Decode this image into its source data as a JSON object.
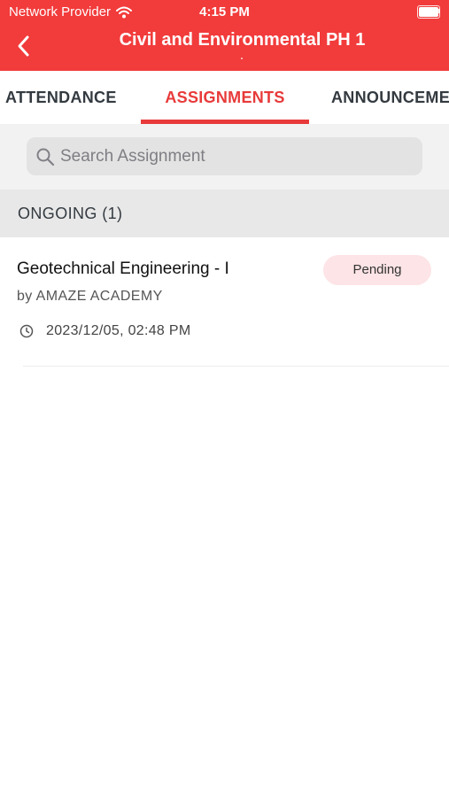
{
  "status_bar": {
    "carrier": "Network Provider",
    "time": "4:15 PM",
    "icons": [
      "wifi-icon",
      "battery-icon"
    ]
  },
  "nav": {
    "title": "Civil and Environmental PH 1",
    "back_icon": "chevron-left-icon"
  },
  "tabs": [
    {
      "label": "ATTENDANCE",
      "active": false
    },
    {
      "label": "ASSIGNMENTS",
      "active": true
    },
    {
      "label": "ANNOUNCEMENTS",
      "active": false
    }
  ],
  "search": {
    "placeholder": "Search Assignment",
    "value": "",
    "icon": "search-icon"
  },
  "section": {
    "title": "ONGOING (1)"
  },
  "assignments": [
    {
      "title": "Geotechnical Engineering - I",
      "author": "by AMAZE ACADEMY",
      "status": "Pending",
      "datetime": "2023/12/05, 02:48 PM",
      "icon": "clock-icon"
    }
  ],
  "colors": {
    "primary": "#f23b3b",
    "active_tab": "#e83a3a",
    "badge_bg": "#fde4e6",
    "search_bg": "#e3e3e3",
    "section_bg": "#e8e8e8"
  }
}
